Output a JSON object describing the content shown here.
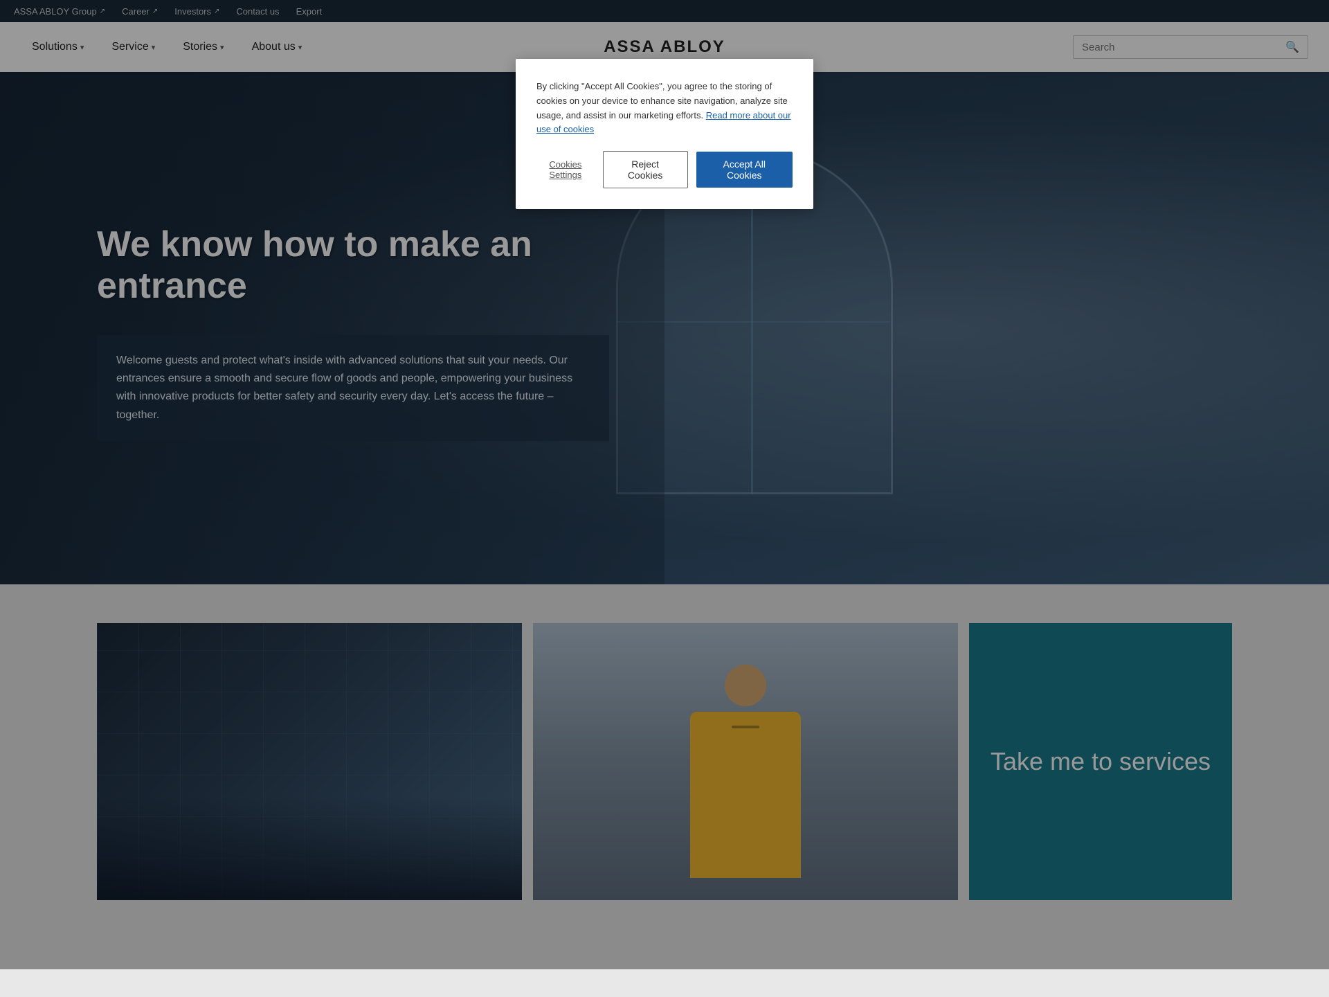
{
  "topbar": {
    "links": [
      {
        "label": "ASSA ABLOY Group",
        "external": true
      },
      {
        "label": "Career",
        "external": true
      },
      {
        "label": "Investors",
        "external": true
      },
      {
        "label": "Contact us",
        "external": false
      },
      {
        "label": "Export",
        "external": false
      }
    ]
  },
  "nav": {
    "logo": "ASSA ABLOY",
    "items": [
      {
        "label": "Solutions",
        "has_dropdown": true
      },
      {
        "label": "Service",
        "has_dropdown": true
      },
      {
        "label": "Stories",
        "has_dropdown": true
      },
      {
        "label": "About us",
        "has_dropdown": true
      }
    ],
    "search_placeholder": "Search"
  },
  "hero": {
    "title": "We know how to make an entrance",
    "description": "Welcome guests and protect what's inside with advanced solutions that suit your needs. Our entrances ensure a smooth and secure flow of goods and people, empowering your business with innovative products for better safety and security every day. Let's access the future – together."
  },
  "bottom_cards": {
    "services_card_text": "Take me to services"
  },
  "cookie": {
    "body_text": "By clicking \"Accept All Cookies\", you agree to the storing of cookies on your device to enhance site navigation, analyze site usage, and assist in our marketing efforts.",
    "link_text": "Read more about our use of cookies",
    "settings_label": "Cookies Settings",
    "reject_label": "Reject Cookies",
    "accept_label": "Accept All Cookies"
  }
}
